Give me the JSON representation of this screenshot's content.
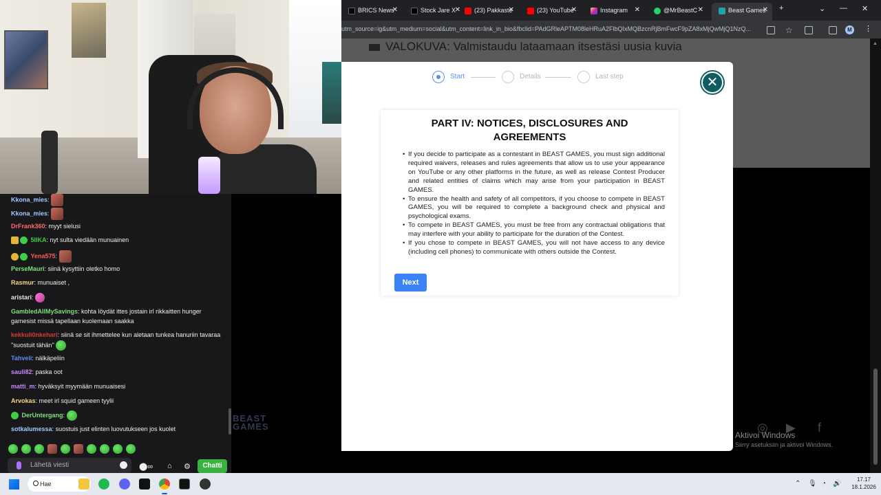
{
  "browser": {
    "tabs": [
      {
        "label": "BRICS News",
        "color": "#000000"
      },
      {
        "label": "Stock Jare X",
        "color": "#000000"
      },
      {
        "label": "(23) Pakkaste",
        "color": "#ff0000"
      },
      {
        "label": "(23) YouTube",
        "color": "#ff0000"
      },
      {
        "label": "Instagram",
        "color": "#d6249f"
      },
      {
        "label": "@MrBeastC",
        "color": "#25d366"
      },
      {
        "label": "Beast Games",
        "color": "#1fa3a3"
      }
    ],
    "url": "utm_source=ig&utm_medium=social&utm_content=link_in_bio&fbclid=PAdGRleAPTM08leHRuA2FlbQIxMQBzcnRjBmFwcF9pZA8xMjQwMjQ1NzQ...",
    "profile_initial": "M",
    "background_heading": "VALOKUVA: Valmistaudu lataamaan itsestäsi uusia kuvia",
    "activate_title": "Aktivoi Windows",
    "activate_sub": "Siirry asetuksiin ja aktivoi Windows."
  },
  "modal": {
    "steps": [
      "Start",
      "Details",
      "Last step"
    ],
    "active_step": 0,
    "title": "PART IV: NOTICES, DISCLOSURES AND AGREEMENTS",
    "bullets": [
      "If you decide to participate as a contestant in BEAST GAMES, you must sign additional required waivers, releases and rules agreements that allow us to use your appearance on YouTube or any other platforms in the future, as well as release Contest Producer and related entities of claims which may arise from your participation in BEAST GAMES.",
      "To ensure the health and safety of all competitors, if you choose to compete in BEAST GAMES, you will be required to complete a background check and physical and psychological exams.",
      "To compete in BEAST GAMES, you must be free from any contractual obligations that may interfere with your ability to participate for the duration of the Contest.",
      "If you chose to compete in BEAST GAMES, you will not have access to any device (including cell phones) to communicate with others outside the Contest."
    ],
    "next_label": "Next",
    "accent": "#3b82f6",
    "close_color": "#0f5c63"
  },
  "chat": {
    "messages": [
      {
        "user": "Kkona_mies",
        "color": "#9ecbff",
        "text": ""
      },
      {
        "user": "Kkona_mies",
        "color": "#9ecbff",
        "text": ""
      },
      {
        "user": "DrFrank360",
        "color": "#ff6b6b",
        "text": "myyt sielusi"
      },
      {
        "user": "5IIKA",
        "color": "#3ecf45",
        "text": "nyt sulta viedään munuainen"
      },
      {
        "user": "Yena575",
        "color": "#ff5a5a",
        "text": ""
      },
      {
        "user": "PerseMauri",
        "color": "#7ee07a",
        "text": "siinä kysyttiin oletko homo"
      },
      {
        "user": "Rasmur",
        "color": "#f5d48a",
        "text": "munuaiset ,"
      },
      {
        "user": "aristari",
        "color": "#e6e6e6",
        "text": ""
      },
      {
        "user": "GambledAllMySavings",
        "color": "#7ee07a",
        "text": "kohta löydät ittes jostain irl rikkaitten hunger gamesist missä tapellaan kuolemaan saakka"
      },
      {
        "user": "kekkuli0nkehari",
        "color": "#d43a3a",
        "text": "siinä se sit ihmettelee kun aletaan tunkea hanuriin tavaraa ''suostuit tähän''"
      },
      {
        "user": "Tahveli",
        "color": "#5b8def",
        "text": "nälkäpeliin"
      },
      {
        "user": "sauli82",
        "color": "#c58af9",
        "text": "paska oot"
      },
      {
        "user": "matti_m",
        "color": "#c58af9",
        "text": "hyväksyit myymään munuaisesi"
      },
      {
        "user": "Arvokas",
        "color": "#f5d48a",
        "text": "meet irl squid gameen tyylii"
      },
      {
        "user": "DerUntergang",
        "color": "#7ee07a",
        "text": ""
      },
      {
        "user": "sotkalumessa",
        "color": "#9ecbff",
        "text": "suostuis just elinten luovutukseen jos kuolet"
      }
    ],
    "input_placeholder": "Lähetä viesti",
    "chat_button": "Chatti",
    "accent": "#3ab23f"
  },
  "taskbar": {
    "search_label": "Hae",
    "time": "17.17",
    "date": "18.1.2026"
  }
}
